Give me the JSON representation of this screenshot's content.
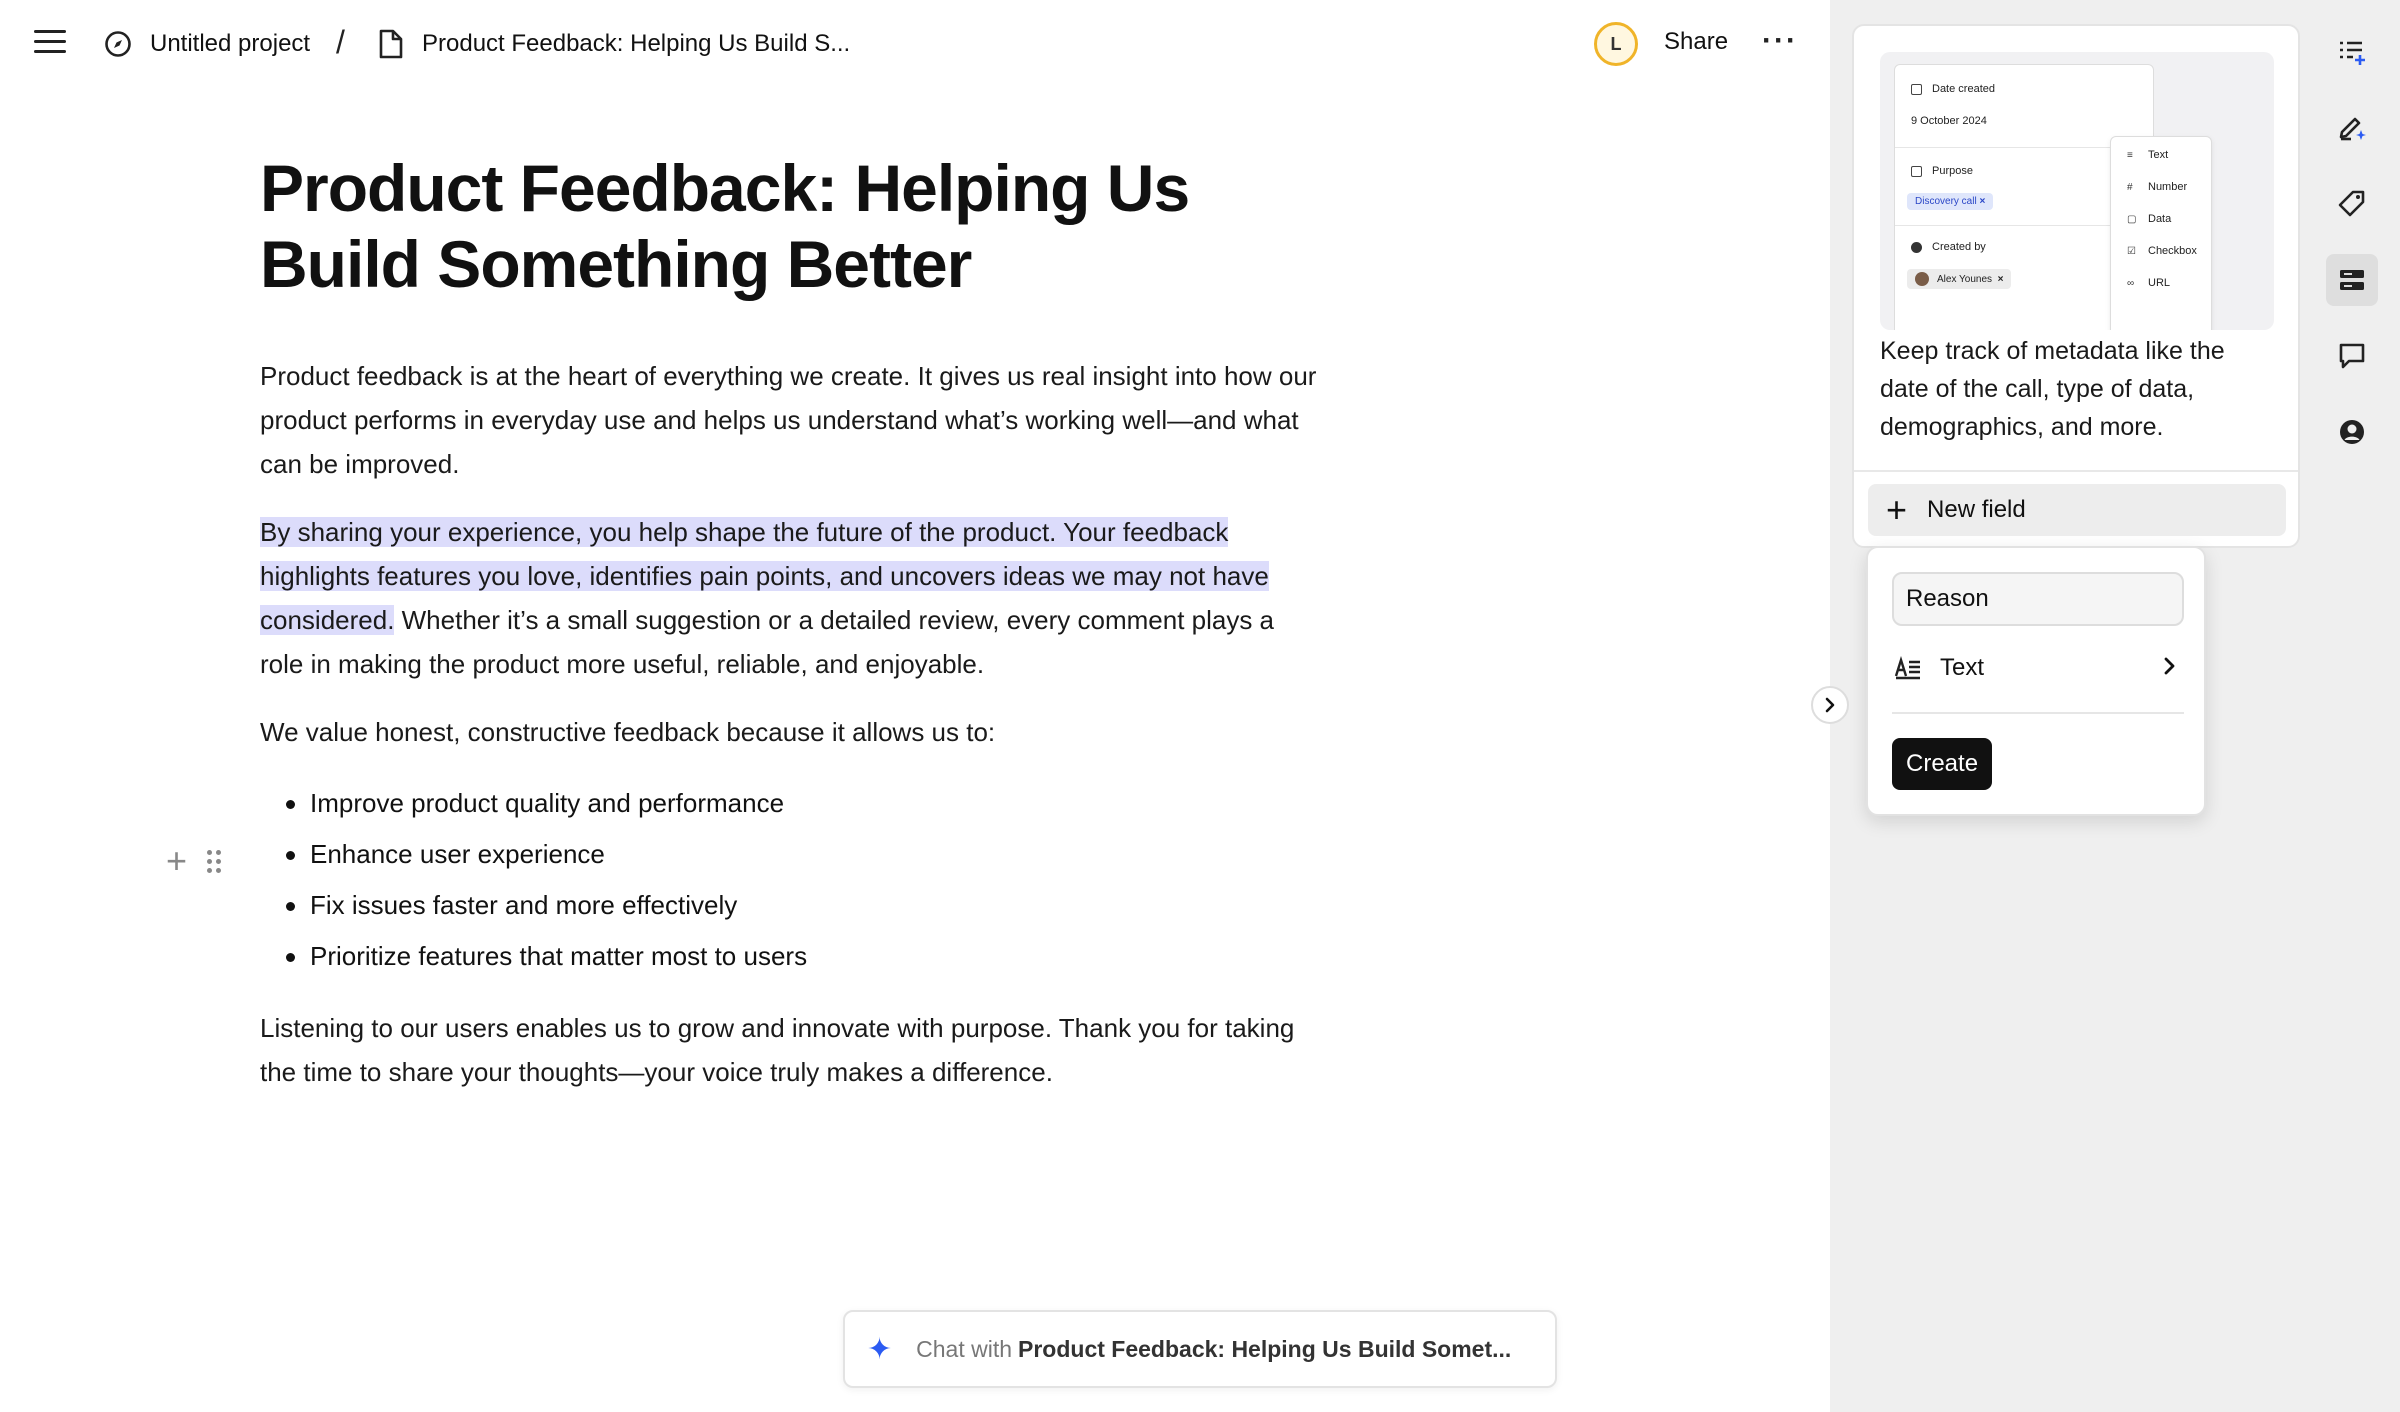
{
  "breadcrumb": {
    "project": "Untitled project",
    "separator": "/",
    "document": "Product Feedback: Helping Us Build S..."
  },
  "header": {
    "avatar_initial": "L",
    "share_label": "Share",
    "more_label": "···"
  },
  "document": {
    "title": "Product Feedback: Helping Us Build Something Better",
    "para1": "Product feedback is at the heart of everything we create. It gives us real insight into how our product performs in everyday use and helps us understand what’s working well—and what can be improved.",
    "para2_highlight": "By sharing your experience, you help shape the future of the product. Your feedback highlights features you love, identifies pain points, and uncovers ideas we may not have considered.",
    "para2_rest": " Whether it’s a small suggestion or a detailed review, every comment plays a role in making the product more useful, reliable, and enjoyable.",
    "para3": "We value honest, constructive feedback because it allows us to:",
    "bullets": [
      "Improve product quality and performance",
      "Enhance user experience",
      "Fix issues faster and more effectively",
      "Prioritize features that matter most to users"
    ],
    "para4": "Listening to our users enables us to grow and innovate with purpose. Thank you for taking the time to share your thoughts—your voice truly makes a difference."
  },
  "chat": {
    "prefix": "Chat with",
    "doc_name": "Product Feedback: Helping Us Build Somet..."
  },
  "metadata_card": {
    "preview": {
      "date_label": "Date created",
      "date_value": "9 October 2024",
      "purpose_label": "Purpose",
      "purpose_chip": "Discovery call",
      "created_by_label": "Created by",
      "created_by_chip": "Alex Younes",
      "chip_remove": "×",
      "menu": [
        "Text",
        "Number",
        "Data",
        "Checkbox",
        "URL"
      ]
    },
    "description": "Keep track of metadata like the date of the call, type of data, demographics, and more.",
    "new_field_label": "New field"
  },
  "new_field_popover": {
    "name_value": "Reason",
    "type_label": "Text",
    "create_label": "Create"
  },
  "colors": {
    "highlight": "#dcdcfb",
    "accent_blue": "#2b5bf2",
    "avatar_ring": "#f0b429",
    "panel_bg": "#efefef"
  },
  "rail_icons": [
    "outline-add-icon",
    "edit-sparkle-icon",
    "tag-icon",
    "metadata-icon",
    "comment-icon",
    "user-circle-icon"
  ]
}
